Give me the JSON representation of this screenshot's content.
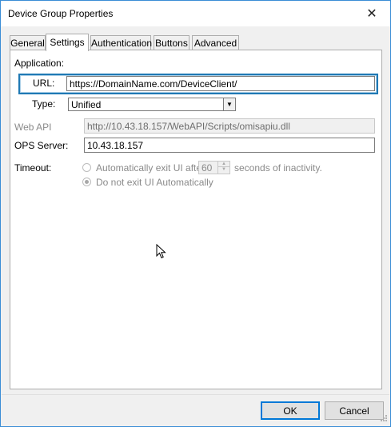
{
  "window": {
    "title": "Device Group Properties",
    "close_glyph": "✕"
  },
  "tabs": [
    {
      "label": "General",
      "active": false
    },
    {
      "label": "Settings",
      "active": true
    },
    {
      "label": "Authentication",
      "active": false
    },
    {
      "label": "Buttons",
      "active": false
    },
    {
      "label": "Advanced",
      "active": false
    }
  ],
  "settings": {
    "application_label": "Application:",
    "url_label": "URL:",
    "url_value": "https://DomainName.com/DeviceClient/",
    "type_label": "Type:",
    "type_value": "Unified",
    "webapi_label": "Web API",
    "webapi_value": "http://10.43.18.157/WebAPI/Scripts/omisapiu.dll",
    "ops_label": "OPS Server:",
    "ops_value": "10.43.18.157",
    "timeout_label": "Timeout:",
    "auto_exit_label": "Automatically exit UI after",
    "auto_exit_seconds": "60",
    "auto_exit_suffix": "seconds of inactivity.",
    "no_exit_label": "Do not exit UI Automatically"
  },
  "footer": {
    "ok_label": "OK",
    "cancel_label": "Cancel"
  },
  "colors": {
    "highlight": "#1f79b4",
    "window_border": "#3a8dd6"
  }
}
